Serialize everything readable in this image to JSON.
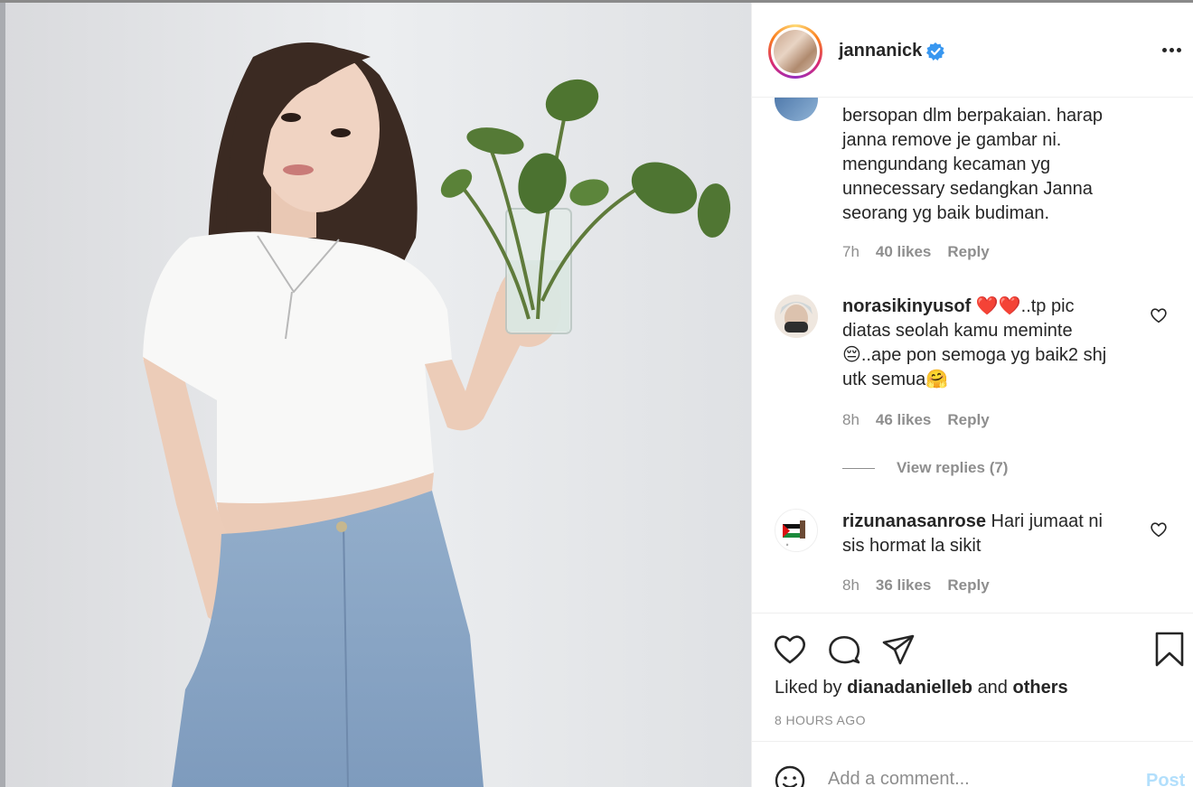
{
  "post": {
    "username": "jannanick",
    "verified": true
  },
  "comments": [
    {
      "username": "",
      "text_lines": [
        "bersopan dlm berpakaian. harap",
        "janna remove je gambar ni.",
        "mengundang kecaman yg",
        "unnecessary sedangkan Janna",
        "seorang yg baik budiman."
      ],
      "time": "7h",
      "likes": "40 likes",
      "reply": "Reply"
    },
    {
      "username": "norasikinyusof",
      "text_lines": [
        "..tp pic",
        "diatas seolah kamu meminte",
        "..ape pon semoga yg baik2 shj",
        "utk semua"
      ],
      "time": "8h",
      "likes": "46 likes",
      "reply": "Reply",
      "view_replies": "View replies (7)"
    },
    {
      "username": "rizunanasanrose",
      "text_lines": [
        "Hari jumaat ni",
        "sis hormat la sikit"
      ],
      "time": "8h",
      "likes": "36 likes",
      "reply": "Reply"
    }
  ],
  "actions": {
    "liked_prefix": "Liked by",
    "liked_user": "dianadanielleb",
    "liked_and": "and",
    "liked_others": "others",
    "time_ago": "8 HOURS AGO"
  },
  "add_comment": {
    "placeholder": "Add a comment...",
    "post_label": "Post"
  },
  "icons": {
    "more": "more-horizontal-icon",
    "like": "heart-icon",
    "comment": "comment-bubble-icon",
    "share": "paper-plane-icon",
    "save": "bookmark-icon",
    "emoji": "smiley-icon",
    "verified": "verified-badge-icon"
  },
  "colors": {
    "verified_blue": "#3897f0",
    "post_disabled": "#b2dffc",
    "muted_text": "#8e8e8e",
    "heart_red": "#e0141e"
  }
}
